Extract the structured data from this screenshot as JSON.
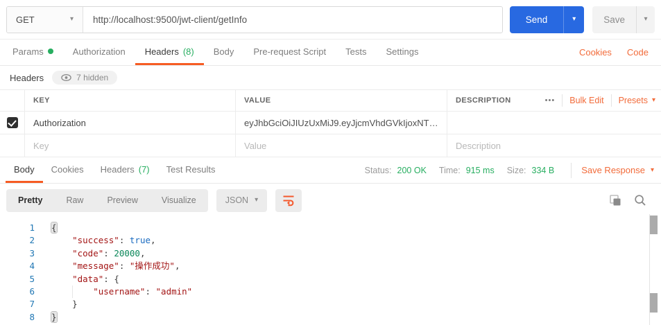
{
  "icons": {
    "caret": "▾",
    "more": "•••"
  },
  "request_bar": {
    "method": "GET",
    "url": "http://localhost:9500/jwt-client/getInfo",
    "send": "Send",
    "save": "Save"
  },
  "request_tabs": {
    "params": "Params",
    "authorization": "Authorization",
    "headers": "Headers",
    "headers_count": "(8)",
    "body": "Body",
    "prerequest": "Pre-request Script",
    "tests": "Tests",
    "settings": "Settings",
    "cookies_link": "Cookies",
    "code_link": "Code"
  },
  "headers_panel": {
    "title": "Headers",
    "hidden_badge": "7 hidden",
    "columns": {
      "key": "KEY",
      "value": "VALUE",
      "description": "DESCRIPTION"
    },
    "bulk_edit": "Bulk Edit",
    "presets": "Presets",
    "row1": {
      "key": "Authorization",
      "value": "eyJhbGciOiJIUzUxMiJ9.eyJjcmVhdGVkIjoxNTg2ODk: ..."
    },
    "new_row_placeholders": {
      "key": "Key",
      "value": "Value",
      "description": "Description"
    }
  },
  "response_panel": {
    "tabs": {
      "body": "Body",
      "cookies": "Cookies",
      "headers": "Headers",
      "headers_count": "(7)",
      "test_results": "Test Results"
    },
    "meta": {
      "status_label": "Status:",
      "status_value": "200 OK",
      "time_label": "Time:",
      "time_value": "915 ms",
      "size_label": "Size:",
      "size_value": "334 B",
      "save_response": "Save Response"
    },
    "toolbar": {
      "pretty": "Pretty",
      "raw": "Raw",
      "preview": "Preview",
      "visualize": "Visualize",
      "format": "JSON"
    }
  },
  "response_body": {
    "json_text": "{\n    \"success\": true,\n    \"code\": 20000,\n    \"message\": \"操作成功\",\n    \"data\": {\n        \"username\": \"admin\"\n    }\n}",
    "lines": [
      {
        "num": "1",
        "tokens": [
          {
            "text": "{"
          }
        ]
      },
      {
        "num": "2",
        "tokens": [
          {
            "text": "    \"success\""
          },
          {
            "text": ": "
          },
          {
            "text": "true"
          },
          {
            "text": ","
          }
        ]
      },
      {
        "num": "3",
        "tokens": [
          {
            "text": "    \"code\""
          },
          {
            "text": ": "
          },
          {
            "text": "20000"
          },
          {
            "text": ","
          }
        ]
      },
      {
        "num": "4",
        "tokens": [
          {
            "text": "    \"message\""
          },
          {
            "text": ": "
          },
          {
            "text": "\"操作成功\""
          },
          {
            "text": ","
          }
        ]
      },
      {
        "num": "5",
        "tokens": [
          {
            "text": "    \"data\""
          },
          {
            "text": ": {"
          }
        ]
      },
      {
        "num": "6",
        "tokens": [
          {
            "text": "        \"username\""
          },
          {
            "text": ": "
          },
          {
            "text": "\"admin\""
          }
        ]
      },
      {
        "num": "7",
        "tokens": [
          {
            "text": "    }"
          }
        ]
      },
      {
        "num": "8",
        "tokens": [
          {
            "text": "}"
          }
        ]
      }
    ]
  },
  "colors": {
    "accent_orange": "#F26B3A",
    "tab_underline_orange": "#F65C23",
    "send_blue": "#2869E1",
    "success_green": "#27AE60",
    "json_key_red": "#A31515",
    "json_number_green": "#098658",
    "json_boolean_blue": "#1A6BC0"
  }
}
